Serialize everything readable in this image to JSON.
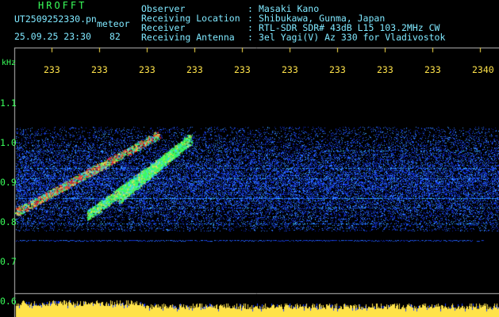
{
  "title": "HROFFT",
  "filename": "UT2509252330.pn",
  "label": "meteor",
  "datetime": "25.09.25 23:30",
  "count": "82",
  "header": [
    {
      "key": "Observer",
      "value": "Masaki Kano"
    },
    {
      "key": "Receiving Location",
      "value": "Shibukawa, Gunma, Japan"
    },
    {
      "key": "Receiver",
      "value": "RTL-SDR SDR# 43dB L15 103.2MHz CW"
    },
    {
      "key": "Receiving Antenna",
      "value": "3el Yagi(V) Az 330 for Vladivostok"
    }
  ],
  "y_unit": "kHz",
  "y_ticks": [
    "1.1",
    "1.0",
    "0.9",
    "0.8",
    "0.7",
    "0.6"
  ],
  "x_ticks": [
    "233",
    "233",
    "233",
    "233",
    "233",
    "233",
    "233",
    "233",
    "233",
    "2340"
  ],
  "colors": {
    "text_green": "#39ff5a",
    "text_cyan": "#7fe8ff",
    "text_yellow": "#ffe34a",
    "signal_red": "#ff2a2a",
    "noise_blue": "#1a40ff"
  }
}
